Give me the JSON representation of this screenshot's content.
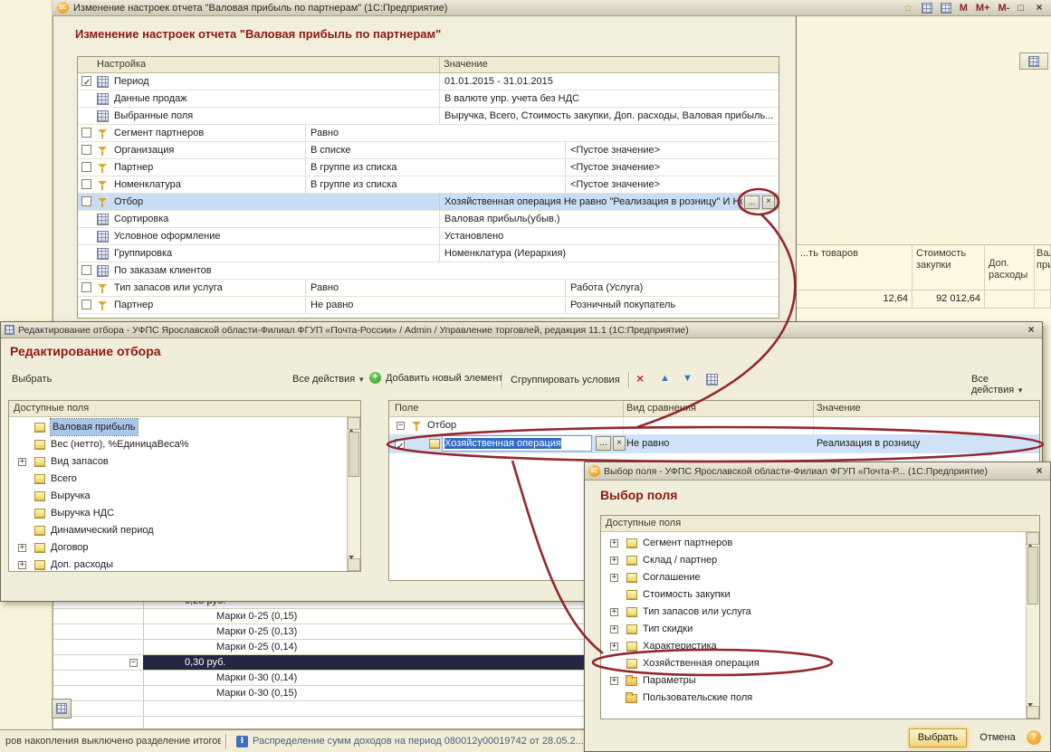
{
  "icons": {
    "star": "☆",
    "maximize": "□",
    "close": "×",
    "dropdown": "▼",
    "up_arrow": "▲",
    "down_arrow": "▼",
    "add_plus": "+",
    "delete_x": "×",
    "expand": "+",
    "collapse": "−",
    "info": "i",
    "help": "?",
    "one_c_logo": "1С"
  },
  "report_settings": {
    "window_title": "Изменение настроек отчета \"Валовая прибыль по партнерам\"  (1С:Предприятие)",
    "memory_buttons": [
      "М",
      "М+",
      "М-"
    ],
    "heading": "Изменение настроек отчета \"Валовая прибыль по партнерам\"",
    "columns": {
      "setting": "Настройка",
      "value": "Значение"
    },
    "rows": [
      {
        "checkbox": "checked",
        "icon": "grid",
        "name": "Период",
        "value": "01.01.2015 - 31.01.2015"
      },
      {
        "checkbox": "none",
        "icon": "grid",
        "name": "Данные продаж",
        "value": "В валюте упр. учета без НДС"
      },
      {
        "checkbox": "none",
        "icon": "grid",
        "name": "Выбранные поля",
        "value": "Выручка, Всего, Стоимость закупки, Доп. расходы, Валовая прибыль..."
      },
      {
        "checkbox": "unchecked",
        "icon": "funnel",
        "name": "Сегмент партнеров",
        "comparison": "Равно",
        "value": ""
      },
      {
        "checkbox": "unchecked",
        "icon": "funnel",
        "name": "Организация",
        "comparison": "В списке",
        "value": "<Пустое значение>"
      },
      {
        "checkbox": "unchecked",
        "icon": "funnel",
        "name": "Партнер",
        "comparison": "В группе из списка",
        "value": "<Пустое значение>"
      },
      {
        "checkbox": "unchecked",
        "icon": "funnel",
        "name": "Номенклатура",
        "comparison": "В группе из списка",
        "value": "<Пустое значение>"
      },
      {
        "checkbox": "unchecked",
        "icon": "funnel",
        "name": "Отбор",
        "value": "Хозяйственная операция Не равно \"Реализация в розницу\" И Но...",
        "selected": true,
        "buttons": [
          "...",
          "×"
        ]
      },
      {
        "checkbox": "none",
        "icon": "grid",
        "name": "Сортировка",
        "value": "Валовая прибыль(убыв.)"
      },
      {
        "checkbox": "none",
        "icon": "grid",
        "name": "Условное оформление",
        "value": "Установлено"
      },
      {
        "checkbox": "none",
        "icon": "grid",
        "name": "Группировка",
        "value": "Номенклатура (Иерархия)"
      },
      {
        "checkbox": "unchecked",
        "icon": "grid",
        "name": "По заказам клиентов",
        "value": ""
      },
      {
        "checkbox": "unchecked",
        "icon": "funnel",
        "name": "Тип запасов или услуга",
        "comparison": "Равно",
        "value": "Работа (Услуга)"
      },
      {
        "checkbox": "unchecked",
        "icon": "funnel",
        "name": "Партнер",
        "comparison": "Не равно",
        "value": "Розничный покупатель"
      }
    ]
  },
  "filter_editor": {
    "window_title": "Редактирование отбора - УФПС Ярославской области-Филиал ФГУП «Почта-России» / Admin / Управление торговлей, редакция 11.1 (1С:Предприятие)",
    "heading": "Редактирование отбора",
    "toolbar": {
      "select_button": "Выбрать",
      "all_actions": "Все действия",
      "add_button": "Добавить новый элемент",
      "group_button": "Сгруппировать условия"
    },
    "available_fields": {
      "header": "Доступные поля",
      "items": [
        {
          "label": "Валовая прибыль",
          "expandable": false,
          "selected": true
        },
        {
          "label": "Вес (нетто), %ЕдиницаВеса%",
          "expandable": false
        },
        {
          "label": "Вид запасов",
          "expandable": true
        },
        {
          "label": "Всего",
          "expandable": false
        },
        {
          "label": "Выручка",
          "expandable": false
        },
        {
          "label": "Выручка НДС",
          "expandable": false
        },
        {
          "label": "Динамический период",
          "expandable": false
        },
        {
          "label": "Договор",
          "expandable": true
        },
        {
          "label": "Доп. расходы",
          "expandable": true
        }
      ]
    },
    "conditions": {
      "columns": [
        "Поле",
        "Вид сравнения",
        "Значение"
      ],
      "group_label": "Отбор",
      "row": {
        "checked": true,
        "field": "Хозяйственная операция",
        "ellipsis_button": "...",
        "clear_button": "×",
        "comparison": "Не равно",
        "value": "Реализация в розницу"
      }
    }
  },
  "field_picker": {
    "window_title": "Выбор поля - УФПС Ярославской области-Филиал ФГУП «Почта-Р...  (1С:Предприятие)",
    "heading": "Выбор поля",
    "list_header": "Доступные поля",
    "items": [
      {
        "label": "Сегмент партнеров",
        "type": "field",
        "expandable": true
      },
      {
        "label": "Склад / партнер",
        "type": "field",
        "expandable": true
      },
      {
        "label": "Соглашение",
        "type": "field",
        "expandable": true
      },
      {
        "label": "Стоимость закупки",
        "type": "field",
        "expandable": false
      },
      {
        "label": "Тип запасов или услуга",
        "type": "field",
        "expandable": true
      },
      {
        "label": "Тип скидки",
        "type": "field",
        "expandable": true
      },
      {
        "label": "Характеристика",
        "type": "field",
        "expandable": true
      },
      {
        "label": "Хозяйственная операция",
        "type": "field",
        "expandable": false
      },
      {
        "label": "Параметры",
        "type": "folder",
        "expandable": true
      },
      {
        "label": "Пользовательские поля",
        "type": "folder",
        "expandable": false
      }
    ],
    "select_button": "Выбрать",
    "cancel_button": "Отмена"
  },
  "background": {
    "report_fragment": {
      "col1": "...ть товаров",
      "col2": "Стоимость закупки",
      "col3": "Доп. расходы",
      "col4_line1": "Вал",
      "col4_line2": "при",
      "value1": "12,64",
      "value2": "92 012,64"
    },
    "marks_table": {
      "rows": [
        {
          "label": "0,25 руб.",
          "type": "group"
        },
        {
          "label": "Марки 0-25 (0,15)",
          "type": "item"
        },
        {
          "label": "Марки 0-25 (0,13)",
          "type": "item"
        },
        {
          "label": "Марки 0-25 (0,14)",
          "type": "item"
        },
        {
          "label": "0,30 руб.",
          "type": "group-selected"
        },
        {
          "label": "Марки 0-30 (0,14)",
          "type": "item"
        },
        {
          "label": "Марки 0-30 (0,15)",
          "type": "item"
        },
        {
          "label": "",
          "type": "empty"
        }
      ]
    },
    "status_bar": {
      "left": "ров накопления выключено разделение итогов!",
      "right": "Распределение сумм доходов на период 080012у00019742 от 28.05.2..."
    }
  }
}
